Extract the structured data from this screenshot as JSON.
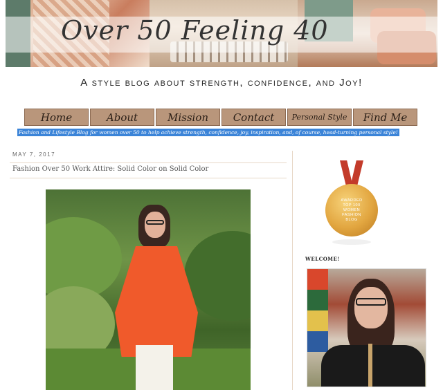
{
  "header": {
    "blog_title": "Over 50 Feeling 40",
    "tagline": "A style blog about strength, confidence, and Joy!"
  },
  "nav": {
    "items": [
      "Home",
      "About",
      "Mission",
      "Contact",
      "Personal Style",
      "Find Me"
    ]
  },
  "description": "Fashion and Lifestyle Blog for women over 50 to help achieve strength, confidence, joy, inspiration, and, of course, head-turning personal style!",
  "post": {
    "date": "MAY 7, 2017",
    "title": "Fashion Over 50 Work Attire: Solid Color on Solid Color"
  },
  "sidebar": {
    "medal": {
      "lines": [
        "AWARDED",
        "TOP 100",
        "WOMEN",
        "FASHION",
        "BLOG"
      ]
    },
    "welcome_heading": "WELCOME!"
  },
  "colors": {
    "nav_bg": "#b9967b",
    "selection_highlight": "#3b84d8",
    "jacket": "#f05a2b",
    "medal_gold": "#e2a640",
    "ribbon": "#c33b2a"
  }
}
